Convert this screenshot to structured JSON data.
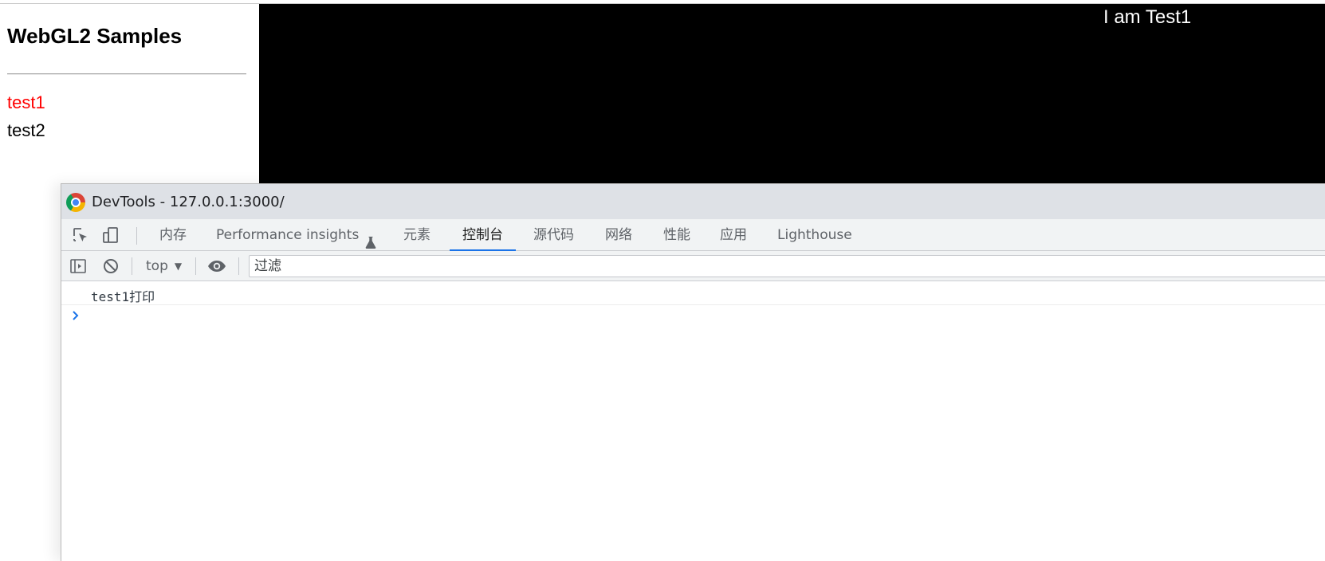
{
  "page": {
    "title": "WebGL2 Samples",
    "nav": [
      {
        "label": "test1",
        "active": true,
        "color": "#ff0000"
      },
      {
        "label": "test2",
        "active": false,
        "color": "#000000"
      }
    ]
  },
  "canvas": {
    "label": "I am Test1",
    "background": "#000000"
  },
  "devtools": {
    "window_title": "DevTools - 127.0.0.1:3000/",
    "tool_icons": [
      "inspect-element-icon",
      "device-toolbar-icon"
    ],
    "tabs": [
      {
        "label": "内存"
      },
      {
        "label": "Performance insights",
        "icon": "flask-icon"
      },
      {
        "label": "元素"
      },
      {
        "label": "控制台",
        "active": true
      },
      {
        "label": "源代码"
      },
      {
        "label": "网络"
      },
      {
        "label": "性能"
      },
      {
        "label": "应用"
      },
      {
        "label": "Lighthouse"
      }
    ],
    "toolbar": {
      "icons": [
        "sidebar-toggle-icon",
        "clear-console-icon",
        "eye-icon"
      ],
      "context": "top",
      "filter_placeholder": "过滤"
    },
    "console": {
      "logs": [
        "test1打印"
      ]
    },
    "accent": "#1a73e8"
  }
}
